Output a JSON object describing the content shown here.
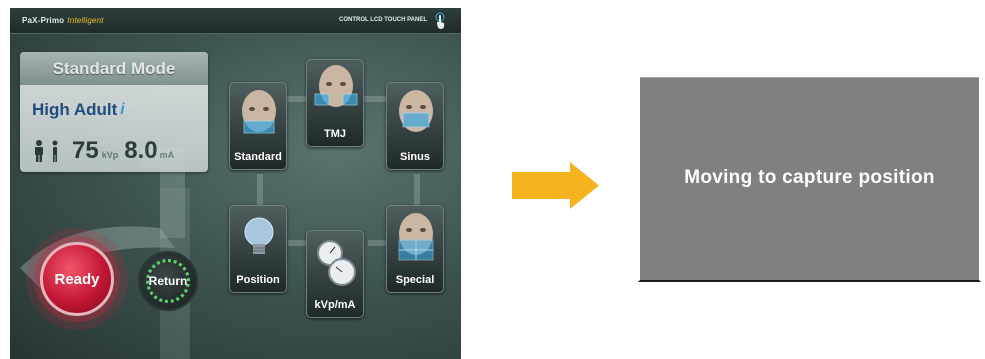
{
  "panel": {
    "brand": "PaX-Primo",
    "brand_suffix": "Intelligent",
    "label": "CONTROL LCD TOUCH PANEL",
    "icon": "touch-hand-icon"
  },
  "mode_card": {
    "title": "Standard Mode",
    "patient_size": "High Adult",
    "info_icon": "i",
    "kvp_value": "75",
    "kvp_unit": "kVp",
    "ma_value": "8.0",
    "ma_unit": "mA"
  },
  "actions": {
    "ready_label": "Ready",
    "return_label": "Return"
  },
  "tiles": {
    "standard": "Standard",
    "tmj": "TMJ",
    "sinus": "Sinus",
    "position": "Position",
    "kvp_ma": "kVp/mA",
    "special": "Special"
  },
  "status": {
    "message": "Moving to capture position"
  },
  "colors": {
    "arrow": "#f5b41e",
    "ready": "#c21734",
    "status_bg": "#808080",
    "accent_text": "#1f4d86"
  }
}
